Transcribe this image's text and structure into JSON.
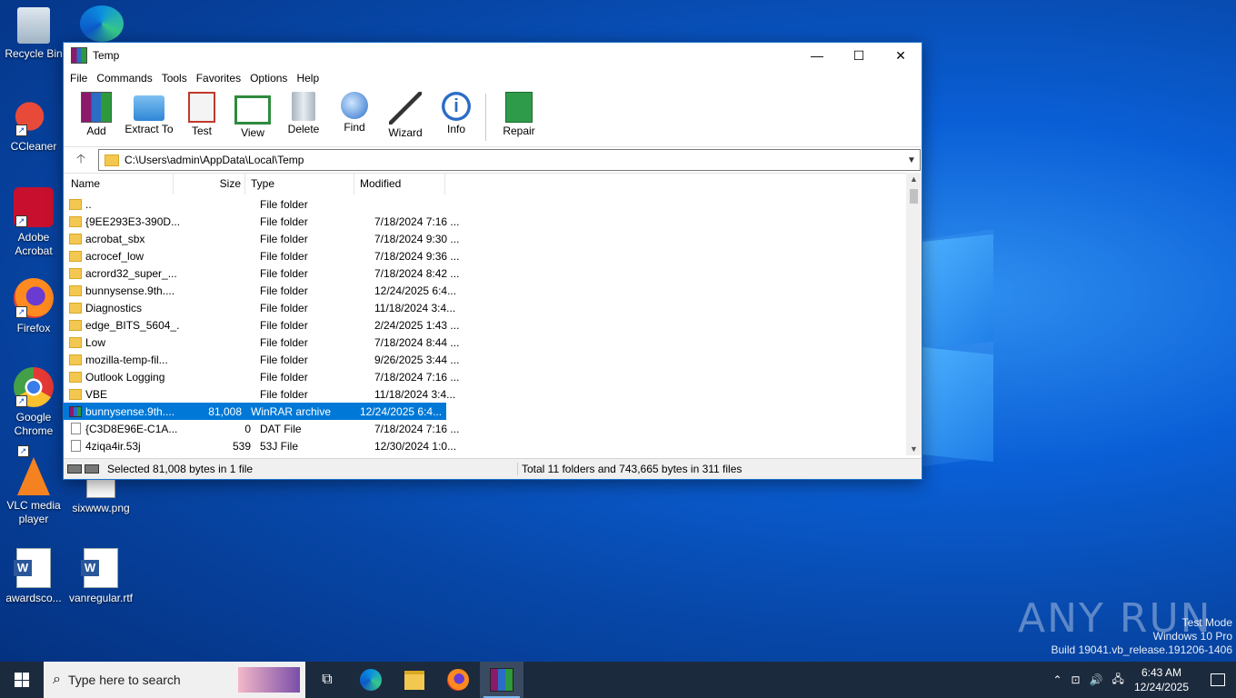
{
  "desktop": {
    "icons": [
      {
        "label": "Recycle Bin"
      },
      {
        "label": "CCleaner"
      },
      {
        "label": "Adobe Acrobat"
      },
      {
        "label": "Firefox"
      },
      {
        "label": "Google Chrome"
      },
      {
        "label": "VLC media player"
      },
      {
        "label": "awardsco..."
      },
      {
        "label": "sixwww.png"
      },
      {
        "label": "vanregular.rtf"
      }
    ],
    "watermark": {
      "brand": "ANY RUN",
      "line1": "Test Mode",
      "line2": "Windows 10 Pro",
      "line3": "Build 19041.vb_release.191206-1406"
    }
  },
  "window": {
    "title": "Temp",
    "menu": [
      "File",
      "Commands",
      "Tools",
      "Favorites",
      "Options",
      "Help"
    ],
    "toolbar": [
      "Add",
      "Extract To",
      "Test",
      "View",
      "Delete",
      "Find",
      "Wizard",
      "Info",
      "Repair"
    ],
    "address": "C:\\Users\\admin\\AppData\\Local\\Temp",
    "columns": {
      "name": "Name",
      "size": "Size",
      "type": "Type",
      "modified": "Modified"
    },
    "rows": [
      {
        "name": "..",
        "size": "",
        "type": "File folder",
        "modified": "",
        "icon": "folder"
      },
      {
        "name": "{9EE293E3-390D...",
        "size": "",
        "type": "File folder",
        "modified": "7/18/2024 7:16 ...",
        "icon": "folder"
      },
      {
        "name": "acrobat_sbx",
        "size": "",
        "type": "File folder",
        "modified": "7/18/2024 9:30 ...",
        "icon": "folder"
      },
      {
        "name": "acrocef_low",
        "size": "",
        "type": "File folder",
        "modified": "7/18/2024 9:36 ...",
        "icon": "folder"
      },
      {
        "name": "acrord32_super_...",
        "size": "",
        "type": "File folder",
        "modified": "7/18/2024 8:42 ...",
        "icon": "folder"
      },
      {
        "name": "bunnysense.9th....",
        "size": "",
        "type": "File folder",
        "modified": "12/24/2025 6:4...",
        "icon": "folder"
      },
      {
        "name": "Diagnostics",
        "size": "",
        "type": "File folder",
        "modified": "11/18/2024 3:4...",
        "icon": "folder"
      },
      {
        "name": "edge_BITS_5604_...",
        "size": "",
        "type": "File folder",
        "modified": "2/24/2025 1:43 ...",
        "icon": "folder"
      },
      {
        "name": "Low",
        "size": "",
        "type": "File folder",
        "modified": "7/18/2024 8:44 ...",
        "icon": "folder"
      },
      {
        "name": "mozilla-temp-fil...",
        "size": "",
        "type": "File folder",
        "modified": "9/26/2025 3:44 ...",
        "icon": "folder"
      },
      {
        "name": "Outlook Logging",
        "size": "",
        "type": "File folder",
        "modified": "7/18/2024 7:16 ...",
        "icon": "folder"
      },
      {
        "name": "VBE",
        "size": "",
        "type": "File folder",
        "modified": "11/18/2024 3:4...",
        "icon": "folder"
      },
      {
        "name": "bunnysense.9th....",
        "size": "81,008",
        "type": "WinRAR archive",
        "modified": "12/24/2025 6:4...",
        "icon": "rar",
        "selected": true
      },
      {
        "name": "{C3D8E96E-C1A...",
        "size": "0",
        "type": "DAT File",
        "modified": "7/18/2024 7:16 ...",
        "icon": "file"
      },
      {
        "name": "4ziqa4ir.53j",
        "size": "539",
        "type": "53J File",
        "modified": "12/30/2024 1:0...",
        "icon": "file"
      }
    ],
    "status_left": "Selected 81,008 bytes in 1 file",
    "status_right": "Total 11 folders and 743,665 bytes in 311 files"
  },
  "taskbar": {
    "search_placeholder": "Type here to search",
    "time": "6:43 AM",
    "date": "12/24/2025"
  }
}
